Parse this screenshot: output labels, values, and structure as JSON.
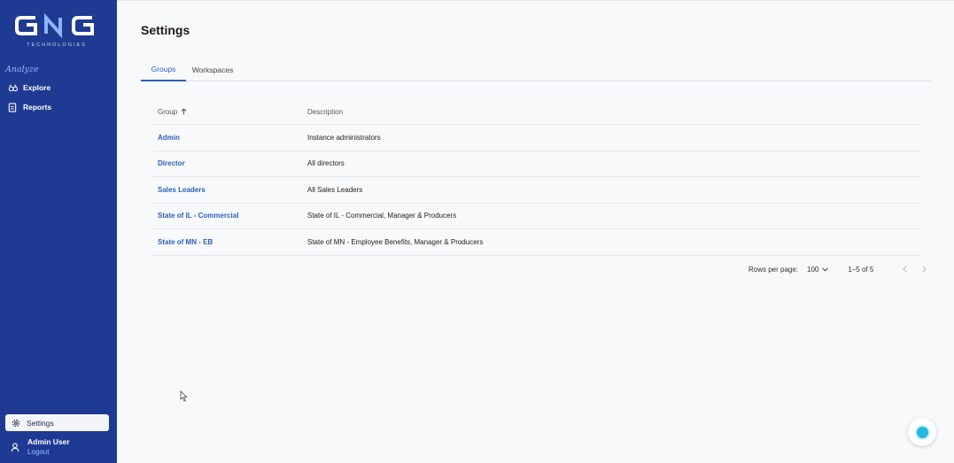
{
  "brand": {
    "sub": "TECHNOLOGIES",
    "accent": "#8fb4ff",
    "sidebar_bg": "#1f3a93"
  },
  "sidebar": {
    "section_label": "Analyze",
    "items": [
      {
        "label": "Explore",
        "icon": "explore-icon"
      },
      {
        "label": "Reports",
        "icon": "report-icon"
      }
    ],
    "settings_label": "Settings",
    "user": {
      "name": "Admin User",
      "logout": "Logout"
    }
  },
  "page": {
    "title": "Settings"
  },
  "tabs": [
    {
      "label": "Groups",
      "active": true
    },
    {
      "label": "Workspaces",
      "active": false
    }
  ],
  "table": {
    "columns": [
      "Group",
      "Description"
    ],
    "rows": [
      {
        "group": "Admin",
        "description": "Instance administrators"
      },
      {
        "group": "Director",
        "description": "All directors"
      },
      {
        "group": "Sales Leaders",
        "description": "All Sales Leaders"
      },
      {
        "group": "State of IL - Commercial",
        "description": "State of IL - Commercial, Manager & Producers"
      },
      {
        "group": "State of MN - EB",
        "description": "State of MN - Employee Benefits, Manager & Producers"
      }
    ]
  },
  "pagination": {
    "rows_per_page_label": "Rows per page:",
    "rows_per_page_value": "100",
    "range": "1–5 of 5"
  }
}
